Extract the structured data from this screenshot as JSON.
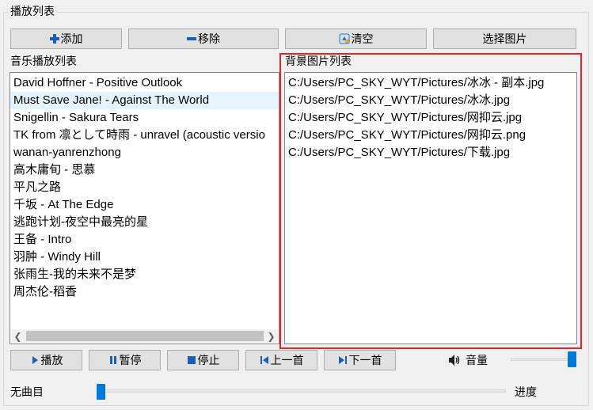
{
  "group": {
    "title": "播放列表"
  },
  "toolbar": {
    "add_label": "添加",
    "remove_label": "移除",
    "clear_label": "清空",
    "select_image_label": "选择图片"
  },
  "music_list": {
    "title": "音乐播放列表",
    "items": [
      "David Hoffner - Positive Outlook",
      "Must Save Jane! - Against The World",
      "Snigellin - Sakura Tears",
      "TK from 凛として時雨 - unravel (acoustic versio",
      "wanan-yanrenzhong",
      "高木庸旬 - 思慕",
      "平凡之路",
      "千坂 - At The Edge",
      "逃跑计划-夜空中最亮的星",
      "王备 - Intro",
      "羽肿 - Windy Hill",
      "张雨生-我的未来不是梦",
      "周杰伦-稻香"
    ]
  },
  "image_list": {
    "title": "背景图片列表",
    "items": [
      "C:/Users/PC_SKY_WYT/Pictures/冰冰 - 副本.jpg",
      "C:/Users/PC_SKY_WYT/Pictures/冰冰.jpg",
      "C:/Users/PC_SKY_WYT/Pictures/网抑云.jpg",
      "C:/Users/PC_SKY_WYT/Pictures/网抑云.png",
      "C:/Users/PC_SKY_WYT/Pictures/下载.jpg"
    ]
  },
  "controls": {
    "play_label": "播放",
    "pause_label": "暂停",
    "stop_label": "停止",
    "prev_label": "上一首",
    "next_label": "下一首",
    "volume_label": "音量",
    "volume_level": 1.0
  },
  "status": {
    "no_track": "无曲目",
    "progress_label": "进度",
    "progress_value": 0.0
  },
  "colors": {
    "highlight_border": "#e3262c",
    "accent": "#0078d7",
    "selected_row": "#e5f3ff"
  },
  "icons": {
    "add": "plus-icon",
    "remove": "minus-icon",
    "clear": "clear-icon",
    "play": "play-icon",
    "pause": "pause-icon",
    "stop": "stop-icon",
    "prev": "previous-icon",
    "next": "next-icon",
    "volume": "speaker-icon"
  }
}
